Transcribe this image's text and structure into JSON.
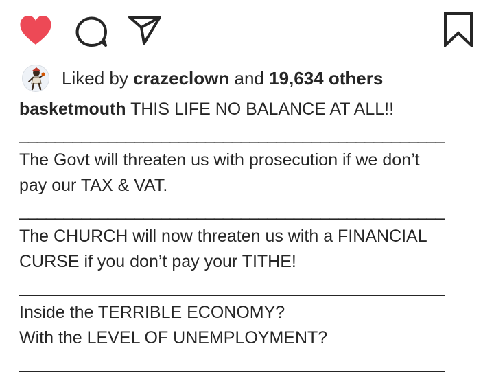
{
  "actions": {
    "like_icon": "heart-filled-icon",
    "comment_icon": "comment-bubble-icon",
    "share_icon": "paper-plane-icon",
    "save_icon": "bookmark-icon",
    "like_color": "#ed4956"
  },
  "likes": {
    "prefix": "Liked by",
    "user": "crazeclown",
    "conjunction": "and",
    "others": "19,634 others"
  },
  "caption": {
    "username": "basketmouth",
    "lines": [
      "THIS LIFE NO BALANCE AT ALL!!",
      "________________________________________________",
      "The Govt will threaten us with prosecution if we don’t",
      "pay our TAX & VAT.",
      "________________________________________________",
      "The CHURCH will now threaten us with a FINANCIAL",
      "CURSE if you don’t pay your TITHE!",
      "________________________________________________",
      "Inside the TERRIBLE ECONOMY?",
      "With the LEVEL OF UNEMPLOYMENT?",
      "________________________________________________"
    ]
  }
}
